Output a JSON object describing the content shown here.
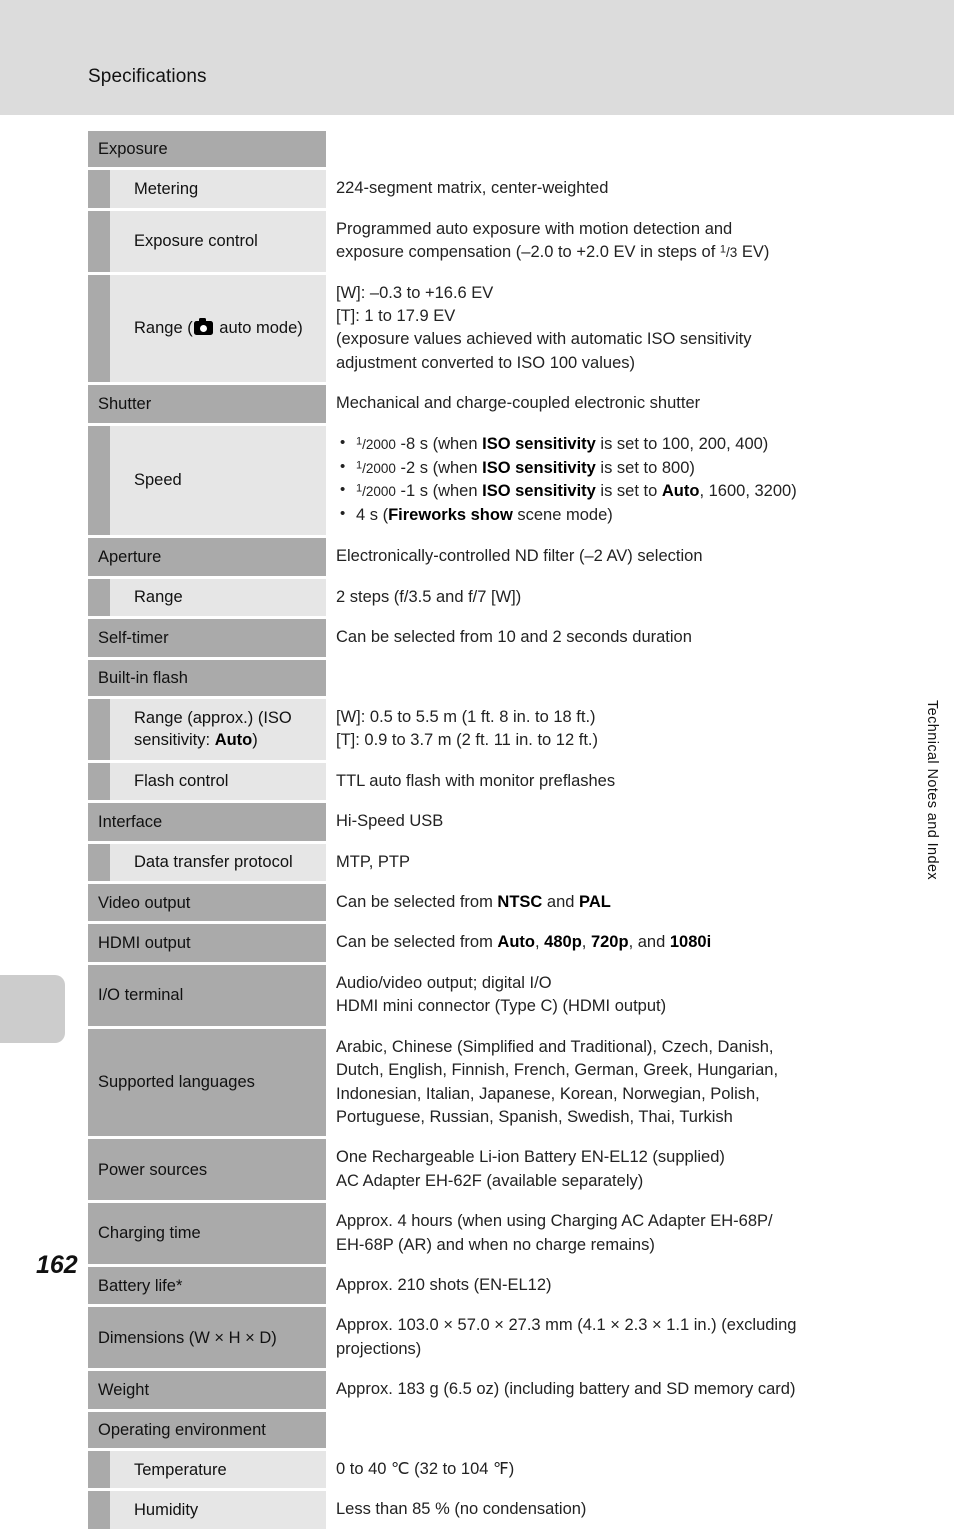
{
  "header": {
    "title": "Specifications"
  },
  "side_tab": {
    "label": "Technical Notes and Index"
  },
  "page": {
    "number": "162"
  },
  "icons": {
    "camera": "camera-icon"
  },
  "colors": {
    "header_band": "#dcdcdc",
    "row_label_main": "#aaaaaa",
    "row_label_sub": "#e6e6e6",
    "page_background": "#ffffff",
    "text": "#111111",
    "edge_tab": "#cccccc"
  },
  "rows": [
    {
      "level": "main",
      "label": "Exposure",
      "value": ""
    },
    {
      "level": "sub",
      "label": "Metering",
      "value": "224-segment matrix, center-weighted"
    },
    {
      "level": "sub",
      "label": "Exposure control",
      "value_line_1": "Programmed auto exposure with motion detection and",
      "value_line_2_a": "exposure compensation (–2.0 to +2.0 EV in steps of ",
      "value_line_2_sup": "1",
      "value_line_2_den": "/3",
      "value_line_2_b": " EV)"
    },
    {
      "level": "sub",
      "label_line_1": "Range",
      "label_line_2_pre": "(",
      "label_line_2_post": " auto mode)",
      "value_line_1": "[W]: –0.3 to +16.6 EV",
      "value_line_2": "[T]: 1 to 17.9 EV",
      "value_line_3": "(exposure values achieved with automatic ISO sensitivity",
      "value_line_4": "adjustment converted to ISO 100 values)"
    },
    {
      "level": "main",
      "label": "Shutter",
      "value": "Mechanical and charge-coupled electronic shutter"
    },
    {
      "level": "sub",
      "label": "Speed",
      "bullets": [
        {
          "sup": "1",
          "den": "/2000",
          "text_a": " -8 s (when ",
          "bold_a": "ISO sensitivity",
          "text_b": " is set to 100, 200, 400)"
        },
        {
          "sup": "1",
          "den": "/2000",
          "text_a": " -2 s (when ",
          "bold_a": "ISO sensitivity",
          "text_b": " is set to 800)"
        },
        {
          "sup": "1",
          "den": "/2000",
          "text_a": " -1 s (when ",
          "bold_a": "ISO sensitivity",
          "text_b": " is set to ",
          "bold_b": "Auto",
          "text_c": ", 1600, 3200)"
        },
        {
          "text_a": "4 s (",
          "bold_a": "Fireworks show",
          "text_b": " scene mode)"
        }
      ]
    },
    {
      "level": "main",
      "label": "Aperture",
      "value": "Electronically-controlled ND filter (–2 AV) selection"
    },
    {
      "level": "sub",
      "label": "Range",
      "value": "2 steps (f/3.5 and f/7 [W])"
    },
    {
      "level": "main",
      "label": "Self-timer",
      "value": "Can be selected from 10 and 2 seconds duration"
    },
    {
      "level": "main",
      "label": "Built-in flash",
      "value": ""
    },
    {
      "level": "sub",
      "label_line_1": "Range (approx.)",
      "label_line_2_pre": "(ISO sensitivity: ",
      "label_line_2_bold": "Auto",
      "label_line_2_post": ")",
      "value_line_1": "[W]: 0.5 to 5.5 m (1 ft. 8 in. to 18 ft.)",
      "value_line_2": "[T]: 0.9 to 3.7 m (2 ft. 11 in. to 12 ft.)"
    },
    {
      "level": "sub",
      "label": "Flash control",
      "value": "TTL auto flash with monitor preflashes"
    },
    {
      "level": "main",
      "label": "Interface",
      "value": "Hi-Speed USB"
    },
    {
      "level": "sub",
      "label": "Data transfer protocol",
      "value": "MTP, PTP"
    },
    {
      "level": "main",
      "label": "Video output",
      "value_a": "Can be selected from ",
      "bold_a": "NTSC",
      "value_b": " and ",
      "bold_b": "PAL"
    },
    {
      "level": "main",
      "label": "HDMI output",
      "value_a": "Can be selected from ",
      "bold_a": "Auto",
      "value_b": ", ",
      "bold_b": "480p",
      "value_c": ", ",
      "bold_c": "720p",
      "value_d": ", and ",
      "bold_d": "1080i"
    },
    {
      "level": "main",
      "label": "I/O terminal",
      "value_line_1": "Audio/video output; digital I/O",
      "value_line_2": "HDMI mini connector (Type C) (HDMI output)"
    },
    {
      "level": "main",
      "label": "Supported languages",
      "value_line_1": "Arabic, Chinese (Simplified and Traditional), Czech, Danish,",
      "value_line_2": "Dutch, English, Finnish, French, German, Greek, Hungarian,",
      "value_line_3": "Indonesian, Italian, Japanese, Korean, Norwegian, Polish,",
      "value_line_4": "Portuguese, Russian, Spanish, Swedish, Thai, Turkish"
    },
    {
      "level": "main",
      "label": "Power sources",
      "value_line_1": "One Rechargeable Li-ion Battery EN-EL12 (supplied)",
      "value_line_2": "AC Adapter EH-62F (available separately)"
    },
    {
      "level": "main",
      "label": "Charging time",
      "value_line_1": "Approx. 4 hours (when using Charging AC Adapter EH-68P/",
      "value_line_2": "EH-68P (AR) and when no charge remains)"
    },
    {
      "level": "main",
      "label": "Battery life*",
      "value": "Approx. 210 shots (EN-EL12)"
    },
    {
      "level": "main",
      "label": "Dimensions (W × H × D)",
      "value_line_1": "Approx. 103.0 × 57.0 × 27.3 mm (4.1 × 2.3 × 1.1 in.) (excluding",
      "value_line_2": "projections)"
    },
    {
      "level": "main",
      "label": "Weight",
      "value": "Approx. 183 g (6.5 oz) (including battery and SD memory card)"
    },
    {
      "level": "main",
      "label": "Operating environment",
      "value": ""
    },
    {
      "level": "sub",
      "label": "Temperature",
      "value": "0 to 40 ℃ (32 to 104 ℉)"
    },
    {
      "level": "sub",
      "label": "Humidity",
      "value": "Less than 85 % (no condensation)"
    }
  ]
}
